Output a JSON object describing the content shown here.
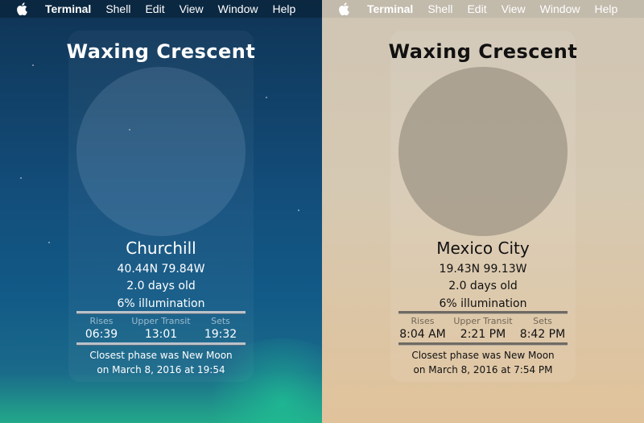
{
  "menubar": {
    "apple_icon": "apple-icon",
    "app_name": "Terminal",
    "items": [
      "Shell",
      "Edit",
      "View",
      "Window",
      "Help"
    ]
  },
  "screens": [
    {
      "phase": "Waxing Crescent",
      "city": "Churchill",
      "coords": "40.44N 79.84W",
      "age": "2.0 days old",
      "illumination": "6% illumination",
      "labels": {
        "rises": "Rises",
        "upper_transit": "Upper Transit",
        "sets": "Sets"
      },
      "times": {
        "rises": "06:39",
        "upper_transit": "13:01",
        "sets": "19:32"
      },
      "closest_line1": "Closest phase was New Moon",
      "closest_line2": "on March 8, 2016 at 19:54"
    },
    {
      "phase": "Waxing Crescent",
      "city": "Mexico City",
      "coords": "19.43N 99.13W",
      "age": "2.0 days old",
      "illumination": "6% illumination",
      "labels": {
        "rises": "Rises",
        "upper_transit": "Upper Transit",
        "sets": "Sets"
      },
      "times": {
        "rises": "8:04 AM",
        "upper_transit": "2:21 PM",
        "sets": "8:42 PM"
      },
      "closest_line1": "Closest phase was New Moon",
      "closest_line2": "on March 8, 2016 at 7:54 PM"
    }
  ],
  "colors": {
    "left_bg": "#134d7a",
    "right_bg": "#d6c9b3"
  }
}
